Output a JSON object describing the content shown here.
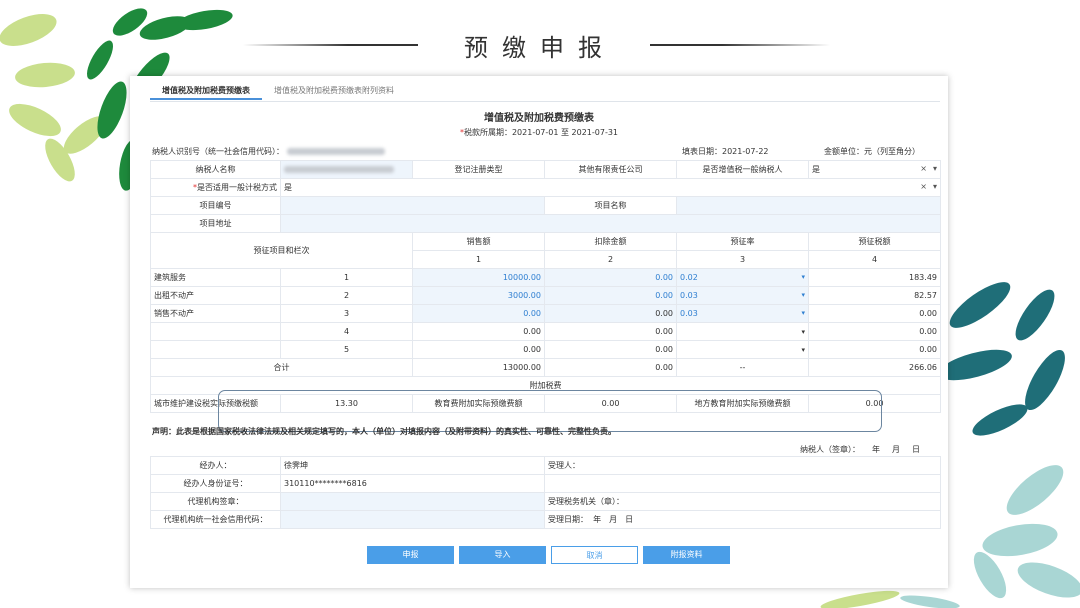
{
  "slide": {
    "title": "预缴申报"
  },
  "tabs": [
    {
      "label": "增值税及附加税费预缴表",
      "active": true
    },
    {
      "label": "增值税及附加税费预缴表附列资料",
      "active": false
    }
  ],
  "form": {
    "title": "增值税及附加税费预缴表",
    "period_label": "税款所属期：",
    "period_value": "2021-07-01 至 2021-07-31",
    "taxpayer_id_label": "纳税人识别号（统一社会信用代码）：",
    "fill_date_label": "填表日期：",
    "fill_date_value": "2021-07-22",
    "unit_label": "金额单位：元（列至角分）",
    "rows": {
      "taxpayer_name_label": "纳税人名称",
      "reg_type_label": "登记注册类型",
      "reg_type_value": "其他有限责任公司",
      "general_taxpayer_label": "是否增值税一般纳税人",
      "general_taxpayer_value": "是",
      "simple_method_label": "是否适用一般计税方式",
      "simple_method_value": "是",
      "clear_icon": "×",
      "dropdown_icon": "▾",
      "project_no_label": "项目编号",
      "project_name_label": "项目名称",
      "project_addr_label": "项目地址"
    },
    "headers": {
      "item_col": "预征项目和栏次",
      "sales": "销售额",
      "deduction": "扣除金额",
      "rate": "预征率",
      "tax": "预征税额",
      "col1": "1",
      "col2": "2",
      "col3": "3",
      "col4": "4"
    },
    "line_items": [
      {
        "name": "建筑服务",
        "no": "1",
        "sales": "10000.00",
        "deduction": "0.00",
        "rate": "0.02",
        "tax": "183.49"
      },
      {
        "name": "出租不动产",
        "no": "2",
        "sales": "3000.00",
        "deduction": "0.00",
        "rate": "0.03",
        "tax": "82.57"
      },
      {
        "name": "销售不动产",
        "no": "3",
        "sales": "0.00",
        "deduction": "0.00",
        "rate": "0.03",
        "tax": "0.00"
      },
      {
        "name": "",
        "no": "4",
        "sales": "0.00",
        "deduction": "0.00",
        "rate": "",
        "tax": "0.00"
      },
      {
        "name": "",
        "no": "5",
        "sales": "0.00",
        "deduction": "0.00",
        "rate": "",
        "tax": "0.00"
      }
    ],
    "total": {
      "label": "合计",
      "sales": "13000.00",
      "deduction": "0.00",
      "rate": "--",
      "tax": "266.06"
    },
    "surcharge": {
      "section_label": "附加税费",
      "urban_label": "城市维护建设税实际预缴税额",
      "urban_value": "13.30",
      "edu_label": "教育费附加实际预缴费额",
      "edu_value": "0.00",
      "local_edu_label": "地方教育附加实际预缴费额",
      "local_edu_value": "0.00"
    },
    "declaration": "声明：此表是根据国家税收法律法规及相关规定填写的，本人（单位）对填报内容（及附带资料）的真实性、可靠性、完整性负责。",
    "signature": {
      "label": "纳税人（签章）：",
      "year": "年",
      "month": "月",
      "day": "日"
    },
    "agent": {
      "handler_label": "经办人：",
      "handler_value": "徐霁坤",
      "handler_id_label": "经办人身份证号：",
      "handler_id_value": "310110********6816",
      "agency_seal_label": "代理机构签章：",
      "agency_code_label": "代理机构统一社会信用代码：",
      "acceptor_label": "受理人：",
      "tax_office_label": "受理税务机关（章）：",
      "accept_date_label": "受理日期：",
      "accept_date_value": "年　月　日"
    }
  },
  "buttons": {
    "submit": "申报",
    "import": "导入",
    "cancel": "取消",
    "attach": "附报资料"
  },
  "colors": {
    "accent": "#4a9ee8",
    "leaf_dark": "#1e8a3c",
    "leaf_light": "#c8df8a",
    "leaf_teal": "#1f6e78",
    "leaf_pale": "#a9d6d4"
  }
}
